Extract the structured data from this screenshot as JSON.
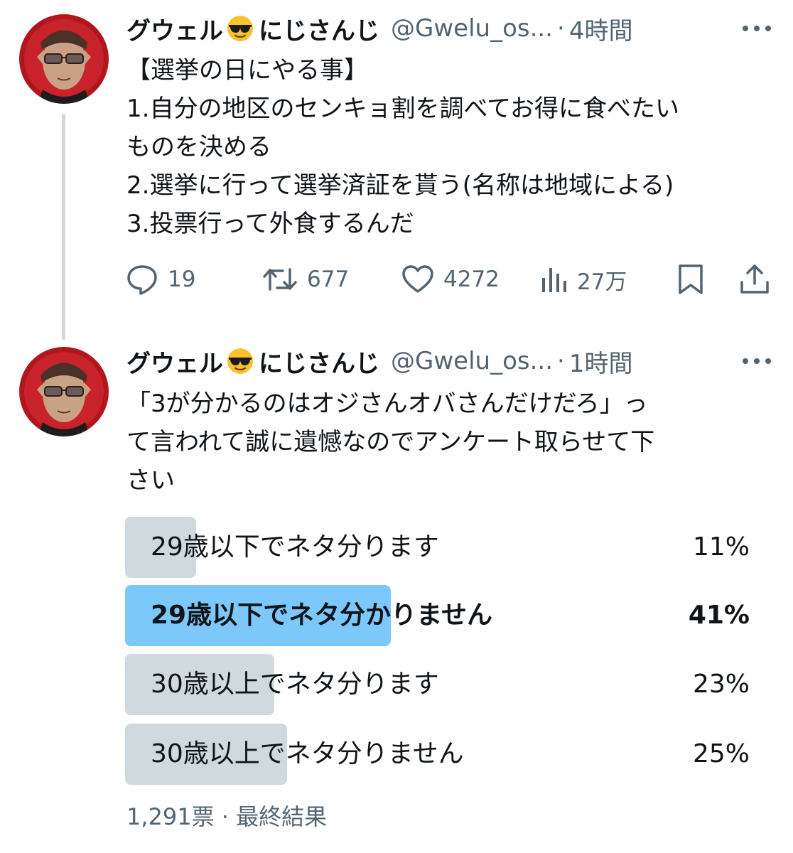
{
  "tweets": [
    {
      "author": {
        "name_part1": "グウェル",
        "emoji": "sunglasses-face-emoji",
        "name_part2": "にじさんじ",
        "handle": "@Gwelu_os...",
        "sep": "·"
      },
      "time": "4時間",
      "text": "【選挙の日にやる事】\n1.自分の地区のセンキョ割を調べてお得に食べたい\nものを決める\n2.選挙に行って選挙済証を貰う(名称は地域による)\n3.投票行って外食するんだ",
      "actions": {
        "replies": "19",
        "retweets": "677",
        "likes": "4272",
        "views": "27万"
      }
    },
    {
      "author": {
        "name_part1": "グウェル",
        "emoji": "sunglasses-face-emoji",
        "name_part2": "にじさんじ",
        "handle": "@Gwelu_os...",
        "sep": "·"
      },
      "time": "1時間",
      "text": "「3が分かるのはオジさんオバさんだけだろ」っ\nて言われて誠に遺憾なのでアンケート取らせて下\nさい",
      "poll": {
        "options": [
          {
            "label": "29歳以下でネタ分ります",
            "percent": "11%",
            "fraction": 0.11,
            "winner": false
          },
          {
            "label": "29歳以下でネタ分かりません",
            "percent": "41%",
            "fraction": 0.41,
            "winner": true
          },
          {
            "label": "30歳以上でネタ分ります",
            "percent": "23%",
            "fraction": 0.23,
            "winner": false
          },
          {
            "label": "30歳以上でネタ分りません",
            "percent": "25%",
            "fraction": 0.25,
            "winner": false
          }
        ],
        "votes": "1,291票",
        "sep": "·",
        "status": "最終結果"
      }
    }
  ],
  "colors": {
    "text": "#0f1419",
    "secondary": "#536471",
    "poll_bar": "#cfd9de",
    "poll_winner": "#7dc8fb",
    "thread_line": "#cfd9de"
  }
}
